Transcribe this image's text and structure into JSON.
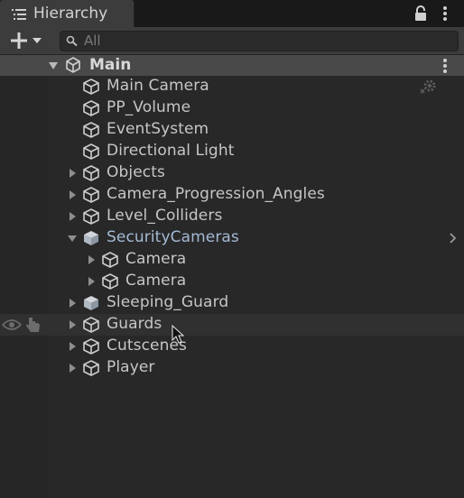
{
  "panel": {
    "tab_label": "Hierarchy",
    "icons": {
      "tab": "hierarchy-list-icon",
      "lock": "lock-icon",
      "menu": "kebab-menu-icon"
    }
  },
  "toolbar": {
    "add_button": "create-plus-dropdown",
    "search": {
      "placeholder": "All",
      "value": ""
    }
  },
  "scene": {
    "name": "Main",
    "expanded": true,
    "icon": "unity-logo-icon"
  },
  "rows": [
    {
      "label": "Main Camera",
      "depth": 0,
      "expander": "none",
      "icon": "gameobject-cube-icon",
      "extra": "settings-icon"
    },
    {
      "label": "PP_Volume",
      "depth": 0,
      "expander": "none",
      "icon": "gameobject-cube-icon"
    },
    {
      "label": "EventSystem",
      "depth": 0,
      "expander": "none",
      "icon": "gameobject-cube-icon"
    },
    {
      "label": "Directional Light",
      "depth": 0,
      "expander": "none",
      "icon": "gameobject-cube-icon"
    },
    {
      "label": "Objects",
      "depth": 0,
      "expander": "collapsed",
      "icon": "gameobject-cube-icon"
    },
    {
      "label": "Camera_Progression_Angles",
      "depth": 0,
      "expander": "collapsed",
      "icon": "gameobject-cube-icon"
    },
    {
      "label": "Level_Colliders",
      "depth": 0,
      "expander": "collapsed",
      "icon": "gameobject-cube-icon"
    },
    {
      "label": "SecurityCameras",
      "depth": 0,
      "expander": "expanded",
      "icon": "prefab-cube-icon",
      "prefab": true,
      "extra": "chevron-right-icon"
    },
    {
      "label": "Camera",
      "depth": 1,
      "expander": "collapsed",
      "icon": "gameobject-cube-icon"
    },
    {
      "label": "Camera",
      "depth": 1,
      "expander": "collapsed",
      "icon": "gameobject-cube-icon"
    },
    {
      "label": "Sleeping_Guard",
      "depth": 0,
      "expander": "collapsed",
      "icon": "prefab-cube-icon"
    },
    {
      "label": "Guards",
      "depth": 0,
      "expander": "collapsed",
      "icon": "gameobject-cube-icon",
      "hovered": true,
      "gutter_icons": [
        "eye-icon",
        "pointing-hand-icon"
      ]
    },
    {
      "label": "Cutscenes",
      "depth": 0,
      "expander": "collapsed",
      "icon": "gameobject-cube-icon"
    },
    {
      "label": "Player",
      "depth": 0,
      "expander": "collapsed",
      "icon": "gameobject-cube-icon"
    }
  ],
  "colors": {
    "background": "#282828",
    "tab_active": "#3c3c3c",
    "scene_header": "#494949",
    "text": "#c6c6c6",
    "prefab_text": "#a5b9d5"
  }
}
